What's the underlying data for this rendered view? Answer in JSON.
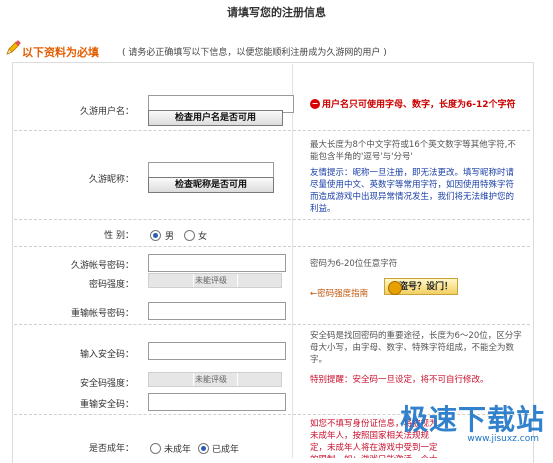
{
  "page": {
    "title": "请填写您的注册信息"
  },
  "section": {
    "heading": "以下资料为必填",
    "note": "( 请务必正确填写以下信息，以便您能顺利注册成为久游网的用户 )"
  },
  "fields": {
    "username": {
      "label": "久游用户名：",
      "check_btn": "检查用户名是否可用",
      "error": "用户名只可使用字母、数字，长度为6-12个字符"
    },
    "nickname": {
      "label": "久游昵称：",
      "check_btn": "检查昵称是否可用",
      "tip": "最大长度为8个中文字符或16个英文数字等其他字符,不能包含半角的'逗号'与'分号'",
      "friendly": "友情提示：昵称一旦注册，即无法更改。填写昵称时请尽量使用中文、英数字等常用字符，如因使用特殊字符而造成游戏中出现异常情况发生，我们将无法维护您的利益。"
    },
    "gender": {
      "label": "性    别：",
      "male": "男",
      "female": "女",
      "selected": "male"
    },
    "password": {
      "label": "久游帐号密码：",
      "tip": "密码为6-20位任意字符",
      "strength_label": "密码强度：",
      "strength_value": "未能评级",
      "confirm_label": "重输帐号密码：",
      "guide": "←密码强度指南",
      "qbtn": "盗号？设门！"
    },
    "security": {
      "label": "输入安全码：",
      "tip": "安全码是找回密码的重要途径，长度为6～20位，区分字母大小写，由字母、数字、特殊字符组成，不能全为数字。",
      "strength_label": "安全码强度：",
      "strength_value": "未能评级",
      "confirm_label": "重输安全码：",
      "warn": "特别提醒：安全码一旦设定，将不可自行修改。"
    },
    "adult": {
      "label": "是否成年：",
      "minor": "未成年",
      "adult": "已成年",
      "selected": "adult",
      "tip": "如您不填写身份证信息，将被视为未成年人，按照国家相关法规规定，未成年人将在游戏中受到一定的限制。如：游戏只能激活一个大人，游戏时长将有限制，等等"
    }
  },
  "watermark": {
    "text": "极速下载站",
    "url": "www.jisuxz.com"
  },
  "colors": {
    "accent": "#e35d00",
    "error": "#cc0000",
    "link": "#1a3fa8"
  }
}
